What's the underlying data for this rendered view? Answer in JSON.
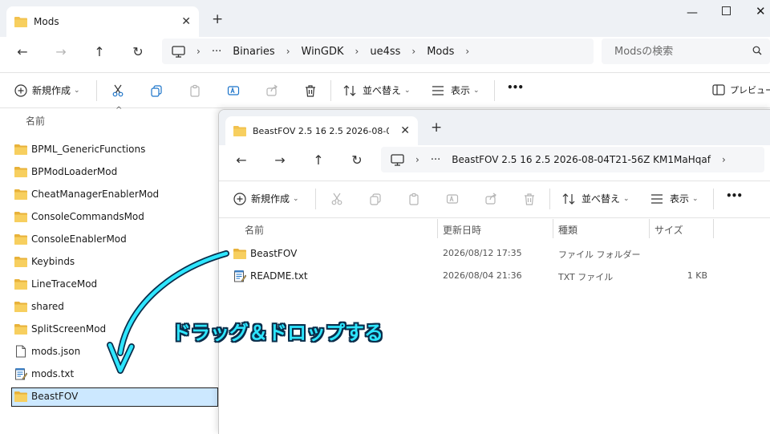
{
  "back_window": {
    "tab_title": "Mods",
    "address": [
      "Binaries",
      "WinGDK",
      "ue4ss",
      "Mods"
    ],
    "search_placeholder": "Modsの検索",
    "toolbar": {
      "new_label": "新規作成",
      "sort_label": "並べ替え",
      "view_label": "表示",
      "more": "•••",
      "preview_label": "プレビュー"
    },
    "column_name": "名前",
    "files": [
      {
        "name": "BPML_GenericFunctions",
        "icon": "folder-icon"
      },
      {
        "name": "BPModLoaderMod",
        "icon": "folder-icon"
      },
      {
        "name": "CheatManagerEnablerMod",
        "icon": "folder-icon"
      },
      {
        "name": "ConsoleCommandsMod",
        "icon": "folder-icon"
      },
      {
        "name": "ConsoleEnablerMod",
        "icon": "folder-icon"
      },
      {
        "name": "Keybinds",
        "icon": "folder-icon"
      },
      {
        "name": "LineTraceMod",
        "icon": "folder-icon"
      },
      {
        "name": "shared",
        "icon": "folder-icon"
      },
      {
        "name": "SplitScreenMod",
        "icon": "folder-icon"
      },
      {
        "name": "mods.json",
        "icon": "file-icon"
      },
      {
        "name": "mods.txt",
        "icon": "text-file-icon"
      },
      {
        "name": "BeastFOV",
        "icon": "folder-icon"
      }
    ]
  },
  "front_window": {
    "tab_title": "BeastFOV 2.5 16 2.5 2026-08-0",
    "address": [
      "BeastFOV 2.5 16 2.5 2026-08-04T21-56Z KM1MaHqaf"
    ],
    "toolbar": {
      "new_label": "新規作成",
      "sort_label": "並べ替え",
      "view_label": "表示",
      "more": "•••"
    },
    "columns": {
      "name": "名前",
      "modified": "更新日時",
      "type": "種類",
      "size": "サイズ"
    },
    "files": [
      {
        "name": "BeastFOV",
        "modified": "2026/08/12 17:35",
        "type": "ファイル フォルダー",
        "size": "",
        "icon": "folder-icon"
      },
      {
        "name": "README.txt",
        "modified": "2026/08/04 21:36",
        "type": "TXT ファイル",
        "size": "1 KB",
        "icon": "text-file-icon"
      }
    ]
  },
  "annotation": {
    "text": "ドラッグ＆ドロップする",
    "color": "#2ee6ff",
    "outline": "#0a2d4a"
  },
  "colors": {
    "folder": "#f2c14e",
    "selection": "#cce8ff",
    "selection_border": "#1e1e1e",
    "tabbar": "#eef1f5",
    "accent_blue": "#1a73c9"
  }
}
